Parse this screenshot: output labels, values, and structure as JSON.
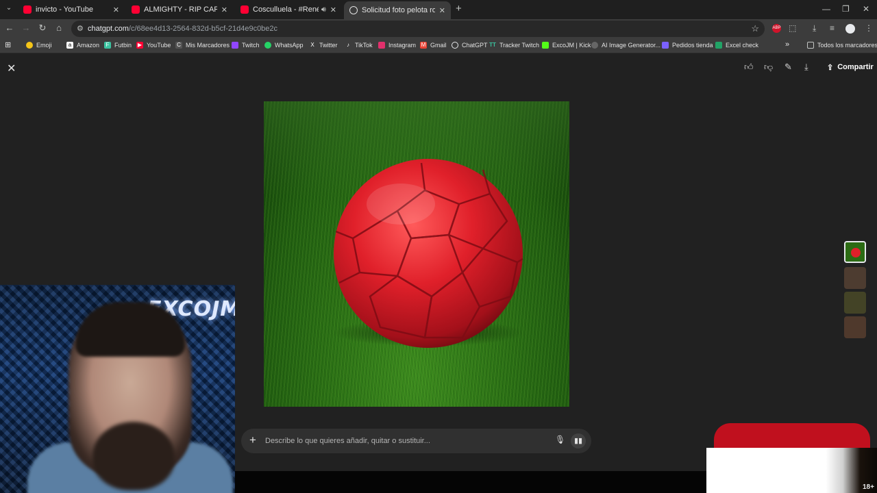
{
  "browser": {
    "tabs": [
      {
        "title": "invicto - YouTube",
        "favicon": "youtube-icon"
      },
      {
        "title": "ALMIGHTY - RIP CARBON (Prod",
        "favicon": "youtube-icon"
      },
      {
        "title": "Cosculluela - #RenéRenunc",
        "favicon": "youtube-icon",
        "audio": true
      },
      {
        "title": "Solicitud foto pelota roja",
        "favicon": "chatgpt-icon",
        "active": true
      }
    ],
    "new_tab": "+",
    "url_host": "chatgpt.com",
    "url_path": "/c/68ee4d13-2564-832d-b5cf-21d4e9c0be2c",
    "bookmarks": [
      {
        "label": "Emoji",
        "icon": "emoji-icon",
        "color": "#f5c518"
      },
      {
        "label": "Amazon",
        "icon": "amazon-icon",
        "color": "#ffffff"
      },
      {
        "label": "Futbin",
        "icon": "futbin-icon",
        "color": "#3ac3a0"
      },
      {
        "label": "YouTube",
        "icon": "youtube-icon",
        "color": "#ff0033"
      },
      {
        "label": "Mis Marcadores",
        "icon": "bookmark-icon",
        "color": "#9aa0a6"
      },
      {
        "label": "Twitch",
        "icon": "twitch-icon",
        "color": "#9146ff"
      },
      {
        "label": "WhatsApp",
        "icon": "whatsapp-icon",
        "color": "#25d366"
      },
      {
        "label": "Twitter",
        "icon": "x-icon",
        "color": "#e8eaed"
      },
      {
        "label": "TikTok",
        "icon": "tiktok-icon",
        "color": "#e8eaed"
      },
      {
        "label": "Instagram",
        "icon": "instagram-icon",
        "color": "#e1306c"
      },
      {
        "label": "Gmail",
        "icon": "gmail-icon",
        "color": "#ea4335"
      },
      {
        "label": "ChatGPT",
        "icon": "chatgpt-icon",
        "color": "#e8eaed"
      },
      {
        "label": "Tracker Twitch",
        "icon": "tracker-icon",
        "color": "#3ac3a0"
      },
      {
        "label": "ExcoJM | Kick",
        "icon": "kick-icon",
        "color": "#53fc18"
      },
      {
        "label": "AI Image Generator...",
        "icon": "ai-icon",
        "color": "#9aa0a6"
      },
      {
        "label": "Pedidos tienda",
        "icon": "store-icon",
        "color": "#7b61ff"
      },
      {
        "label": "Excel check",
        "icon": "excel-icon",
        "color": "#21a366"
      }
    ],
    "all_bookmarks": "Todos los marcadores"
  },
  "page": {
    "share_label": "Compartir",
    "prompt_placeholder": "Describe lo que quieres añadir, quitar o sustituir...",
    "thumbnail_count": 4
  },
  "overlay": {
    "webcam_neon": "EXCOJM",
    "age_label": "18+"
  },
  "colors": {
    "page_bg": "#212121",
    "ball": "#e0202a",
    "red_pill": "#c0101e"
  }
}
